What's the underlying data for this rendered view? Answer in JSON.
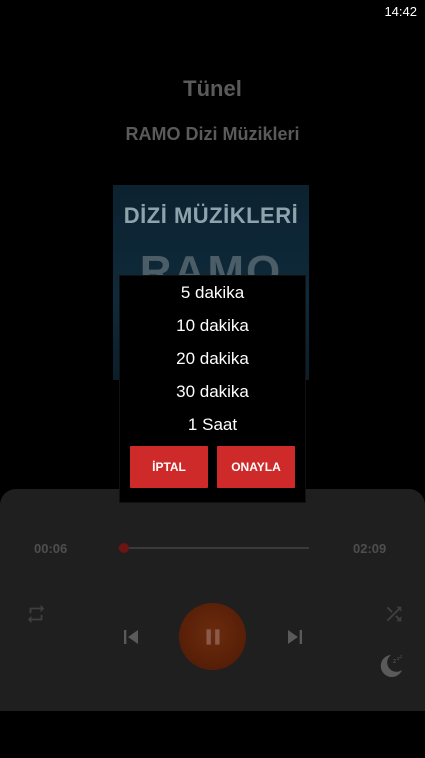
{
  "status": {
    "time": "14:42"
  },
  "player": {
    "song_title": "Tünel",
    "album_name": "RAMO Dizi Müzikleri",
    "album_art": {
      "text": "DİZİ MÜZİKLERİ",
      "big": "RAMO"
    },
    "time_current": "00:06",
    "time_total": "02:09",
    "progress": 0.05,
    "icons": {
      "repeat": "repeat-icon",
      "previous": "skip-previous-icon",
      "play_pause": "pause-icon",
      "next": "skip-next-icon",
      "shuffle": "shuffle-icon",
      "sleep": "sleep-moon-icon"
    }
  },
  "sleep_dialog": {
    "options": [
      "5 dakika",
      "10 dakika",
      "20 dakika",
      "30 dakika",
      "1 Saat"
    ],
    "cancel_label": "İPTAL",
    "confirm_label": "ONAYLA"
  },
  "colors": {
    "accent_red": "#cf2a2a",
    "panel_bg": "#1f1f1f",
    "dim_text": "#5a5a5a"
  }
}
